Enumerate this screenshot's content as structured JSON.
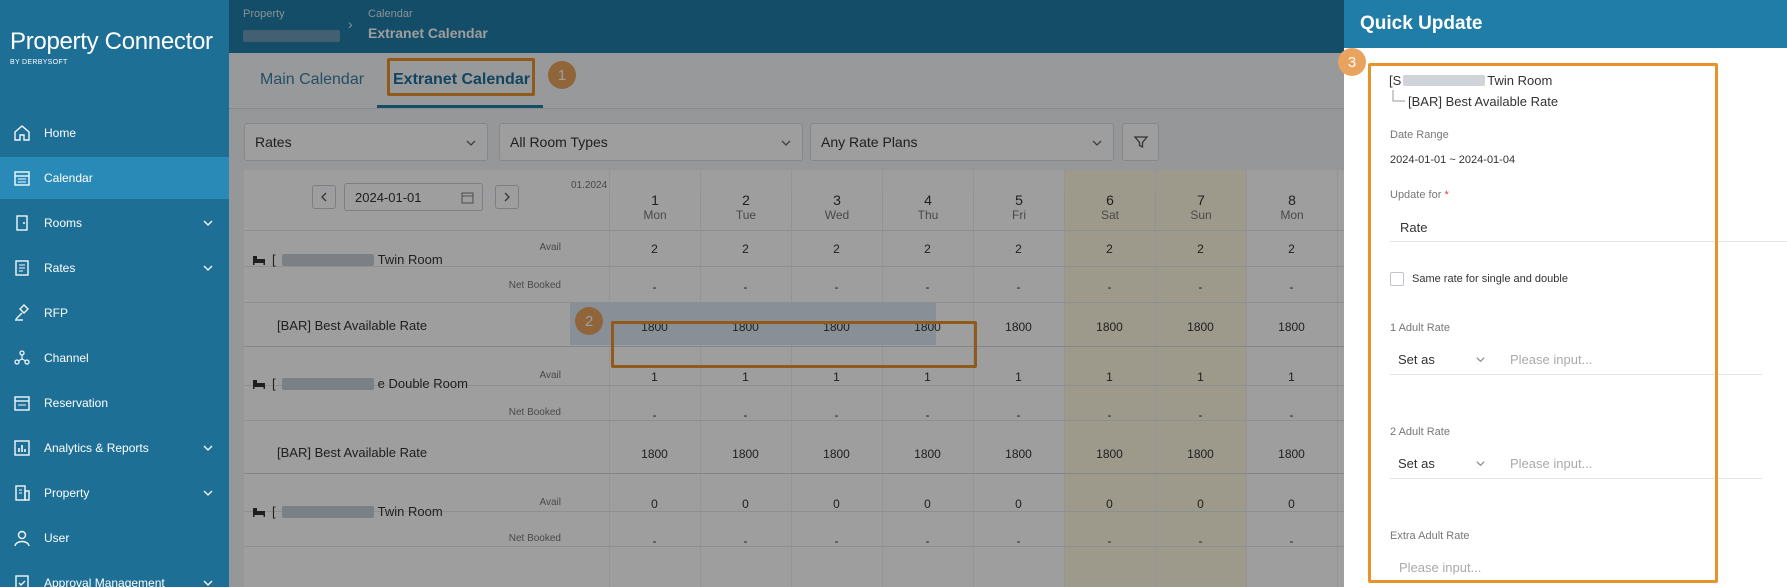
{
  "app": {
    "logo": "Property Connector",
    "logo_sub": "BY DERBYSOFT"
  },
  "sidebar": {
    "items": [
      {
        "label": "Home",
        "icon": "home-icon"
      },
      {
        "label": "Calendar",
        "icon": "calendar-icon",
        "active": true
      },
      {
        "label": "Rooms",
        "icon": "door-icon",
        "expand": true
      },
      {
        "label": "Rates",
        "icon": "rates-icon",
        "expand": true
      },
      {
        "label": "RFP",
        "icon": "gavel-icon"
      },
      {
        "label": "Channel",
        "icon": "channel-icon"
      },
      {
        "label": "Reservation",
        "icon": "reservation-icon"
      },
      {
        "label": "Analytics & Reports",
        "icon": "chart-icon",
        "expand": true
      },
      {
        "label": "Property",
        "icon": "building-icon",
        "expand": true
      },
      {
        "label": "User",
        "icon": "user-icon"
      },
      {
        "label": "Approval Management",
        "icon": "approval-icon",
        "expand": true
      }
    ]
  },
  "breadcrumb": {
    "property_label": "Property",
    "calendar_label": "Calendar",
    "current": "Extranet Calendar"
  },
  "tabs": {
    "main": "Main Calendar",
    "extranet": "Extranet Calendar"
  },
  "callouts": {
    "one": "1",
    "two": "2",
    "three": "3"
  },
  "filters": {
    "view": "Rates",
    "room_types": "All Room Types",
    "rate_plans": "Any Rate Plans"
  },
  "date_picker": {
    "value": "2024-01-01"
  },
  "grid": {
    "month": "01.2024",
    "days": [
      {
        "n": "1",
        "w": "Mon"
      },
      {
        "n": "2",
        "w": "Tue"
      },
      {
        "n": "3",
        "w": "Wed"
      },
      {
        "n": "4",
        "w": "Thu"
      },
      {
        "n": "5",
        "w": "Fri"
      },
      {
        "n": "6",
        "w": "Sat"
      },
      {
        "n": "7",
        "w": "Sun"
      },
      {
        "n": "8",
        "w": "Mon"
      }
    ],
    "avail_label": "Avail",
    "netbooked_label": "Net Booked",
    "rooms": [
      {
        "prefix": "[",
        "suffix": "Twin Room",
        "avail": [
          "2",
          "2",
          "2",
          "2",
          "2",
          "2",
          "2",
          "2"
        ],
        "booked": [
          "-",
          "-",
          "-",
          "-",
          "-",
          "-",
          "-",
          "-"
        ],
        "rate_plan": "[BAR] Best Available Rate",
        "rates": [
          "1800",
          "1800",
          "1800",
          "1800",
          "1800",
          "1800",
          "1800",
          "1800"
        ]
      },
      {
        "prefix": "[",
        "suffix": "e Double Room",
        "avail": [
          "1",
          "1",
          "1",
          "1",
          "1",
          "1",
          "1",
          "1"
        ],
        "booked": [
          "-",
          "-",
          "-",
          "-",
          "-",
          "-",
          "-",
          "-"
        ],
        "rate_plan": "[BAR] Best Available Rate",
        "rates": [
          "1800",
          "1800",
          "1800",
          "1800",
          "1800",
          "1800",
          "1800",
          "1800"
        ]
      },
      {
        "prefix": "[",
        "suffix": "Twin Room",
        "avail": [
          "0",
          "0",
          "0",
          "0",
          "0",
          "0",
          "0",
          "0"
        ],
        "booked": [
          "-",
          "-",
          "-",
          "-",
          "-",
          "-",
          "-",
          "-"
        ]
      }
    ]
  },
  "panel": {
    "title": "Quick Update",
    "room_prefix": "[S",
    "room_suffix": "Twin Room",
    "rate_plan": "[BAR] Best Available Rate",
    "date_range_label": "Date Range",
    "date_range": "2024-01-01 ~ 2024-01-04",
    "update_for_label": "Update for",
    "required_mark": "*",
    "update_for_value": "Rate",
    "same_rate_label": "Same rate for single and double",
    "adult1_label": "1 Adult Rate",
    "adult2_label": "2 Adult Rate",
    "setas": "Set as",
    "placeholder": "Please input...",
    "extra_adult_label": "Extra Adult Rate"
  },
  "colors": {
    "accent": "#1f7da8",
    "highlight": "#e8922a",
    "badge": "#e8a35e"
  }
}
